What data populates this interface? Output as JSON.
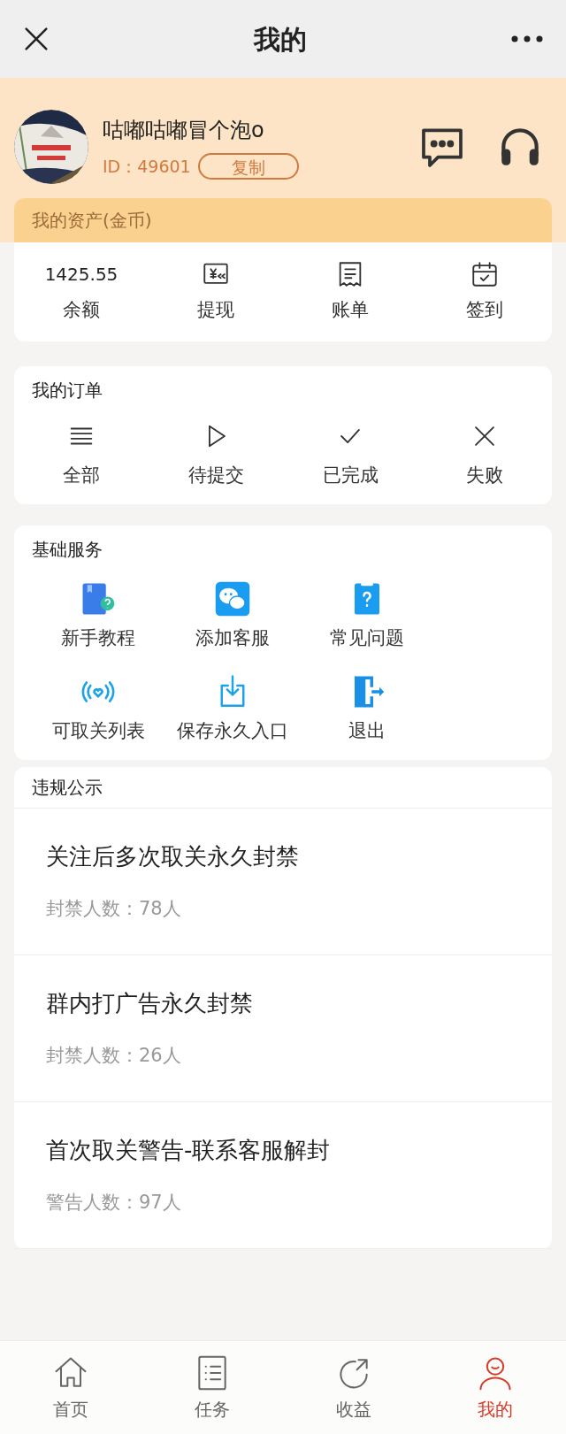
{
  "header": {
    "title": "我的"
  },
  "profile": {
    "name": "咕嘟咕嘟冒个泡o",
    "id_label": "ID：",
    "id": "49601",
    "copy_button": "复制"
  },
  "assets": {
    "title": "我的资产(金币)",
    "items": [
      {
        "kind": "value",
        "value": "1425.55",
        "label": "余额"
      },
      {
        "kind": "withdraw",
        "label": "提现"
      },
      {
        "kind": "bill",
        "label": "账单"
      },
      {
        "kind": "checkin",
        "label": "签到"
      }
    ]
  },
  "orders": {
    "title": "我的订单",
    "items": [
      {
        "kind": "all",
        "label": "全部"
      },
      {
        "kind": "pending",
        "label": "待提交"
      },
      {
        "kind": "done",
        "label": "已完成"
      },
      {
        "kind": "failed",
        "label": "失败"
      }
    ]
  },
  "services": {
    "title": "基础服务",
    "items": [
      {
        "kind": "tutorial",
        "label": "新手教程"
      },
      {
        "kind": "wechat",
        "label": "添加客服"
      },
      {
        "kind": "faq",
        "label": "常见问题"
      },
      {
        "kind": "signal",
        "label": "可取关列表"
      },
      {
        "kind": "save",
        "label": "保存永久入口"
      },
      {
        "kind": "exit",
        "label": "退出"
      }
    ]
  },
  "violations": {
    "title": "违规公示",
    "items": [
      {
        "title": "关注后多次取关永久封禁",
        "count": "封禁人数：78人"
      },
      {
        "title": "群内打广告永久封禁",
        "count": "封禁人数：26人"
      },
      {
        "title": "首次取关警告-联系客服解封",
        "count": "警告人数：97人"
      }
    ]
  },
  "tabbar": [
    {
      "kind": "home",
      "label": "首页",
      "selected": false
    },
    {
      "kind": "tasks",
      "label": "任务",
      "selected": false
    },
    {
      "kind": "share",
      "label": "收益",
      "selected": false
    },
    {
      "kind": "me",
      "label": "我的",
      "selected": true
    }
  ]
}
